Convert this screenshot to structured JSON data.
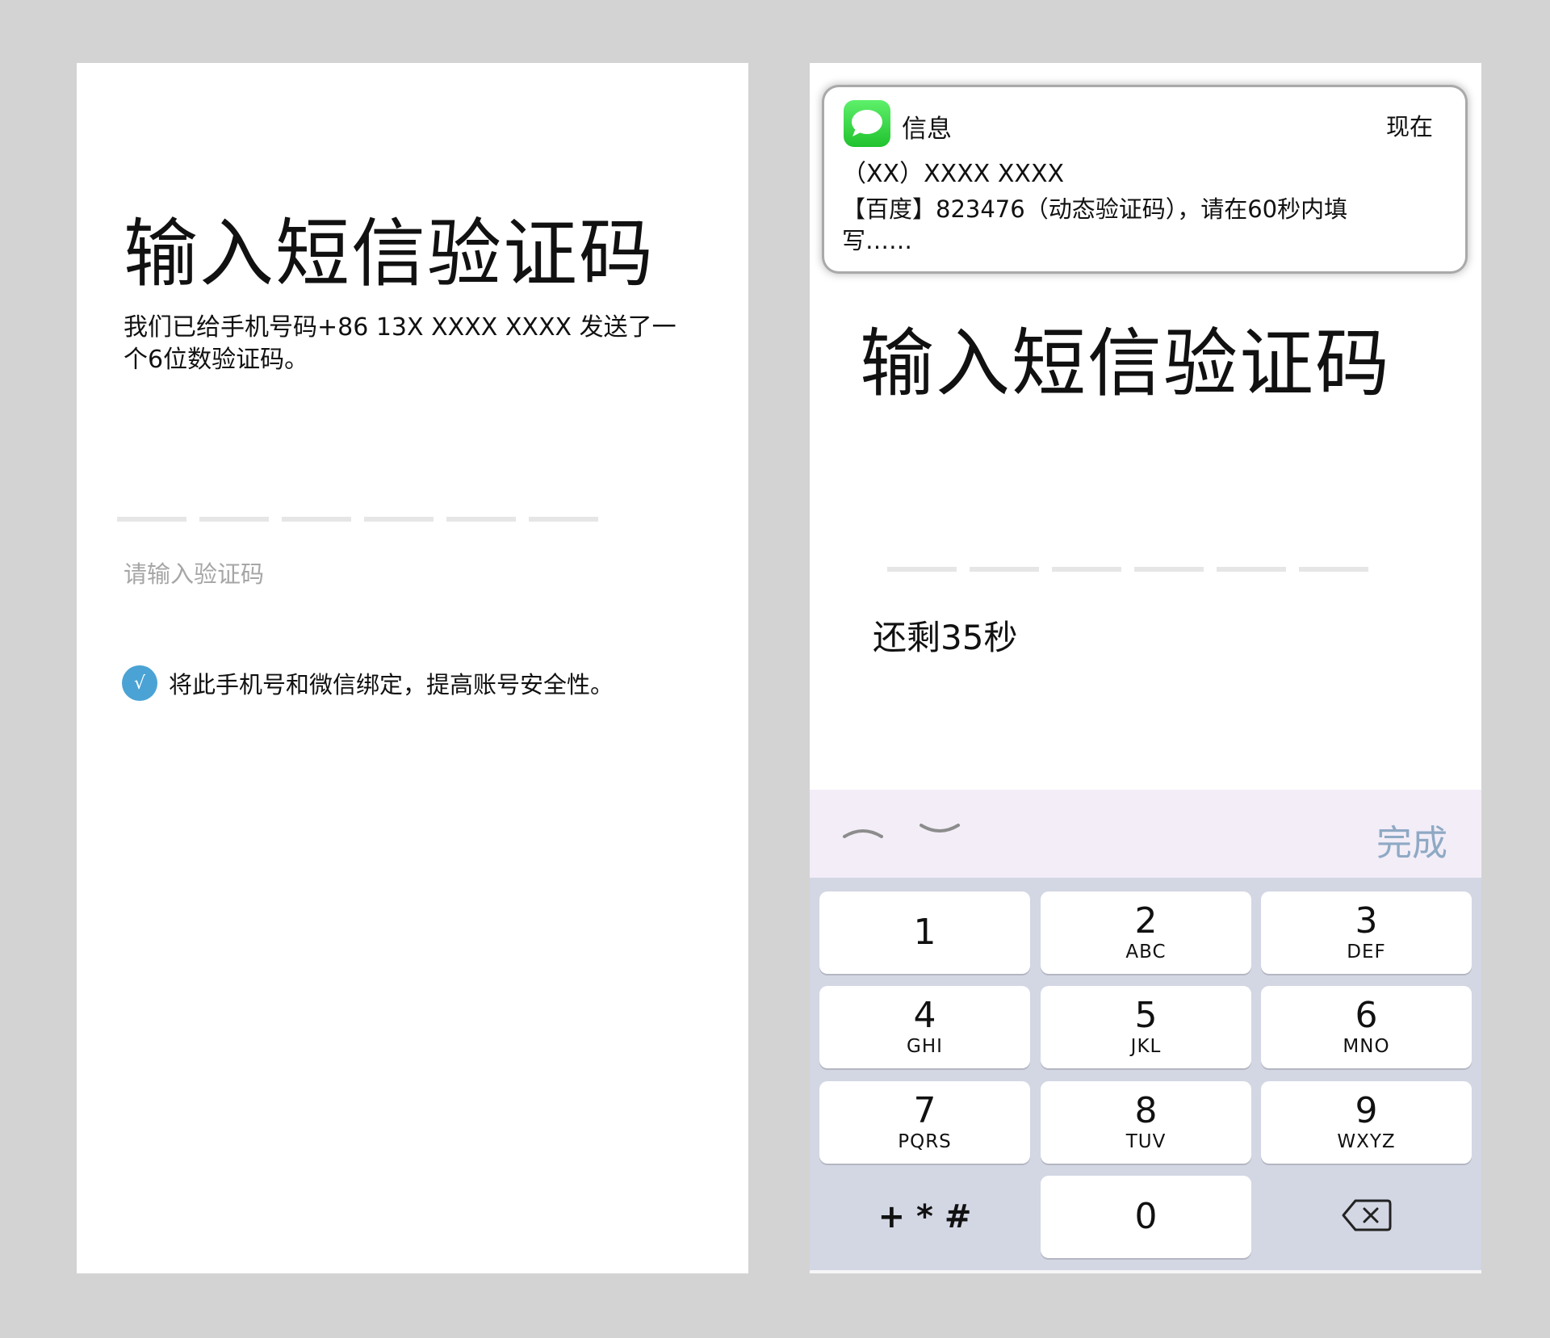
{
  "left_screen": {
    "title": "输入短信验证码",
    "description": "我们已给手机号码+86 13X XXXX XXXX 发送了一个6位数验证码。",
    "placeholder": "请输入验证码",
    "checkbox_mark": "√",
    "bind_text": "将此手机号和微信绑定，提高账号安全性。"
  },
  "right_screen": {
    "notification": {
      "icon": "messages-app-icon",
      "app_name": "信息",
      "time": "现在",
      "sender": "（XX）XXXX XXXX",
      "body": "【百度】823476（动态验证码），请在60秒内填写……"
    },
    "title": "输入短信验证码",
    "countdown": "还剩35秒",
    "keyboard": {
      "done_label": "完成",
      "keys": [
        {
          "digit": "1",
          "letters": ""
        },
        {
          "digit": "2",
          "letters": "ABC"
        },
        {
          "digit": "3",
          "letters": "DEF"
        },
        {
          "digit": "4",
          "letters": "GHI"
        },
        {
          "digit": "5",
          "letters": "JKL"
        },
        {
          "digit": "6",
          "letters": "MNO"
        },
        {
          "digit": "7",
          "letters": "PQRS"
        },
        {
          "digit": "8",
          "letters": "TUV"
        },
        {
          "digit": "9",
          "letters": "WXYZ"
        },
        {
          "digit": "0",
          "letters": ""
        }
      ],
      "symbols_label": "+ * #"
    }
  },
  "colors": {
    "background": "#d3d3d3",
    "accent_blue": "#4aa3d4",
    "done_blue": "#8fa9c4",
    "keyboard_bg": "#d3d6e3",
    "toolbar_bg": "#f2edf7",
    "placeholder_gray": "#a6a6a6"
  }
}
